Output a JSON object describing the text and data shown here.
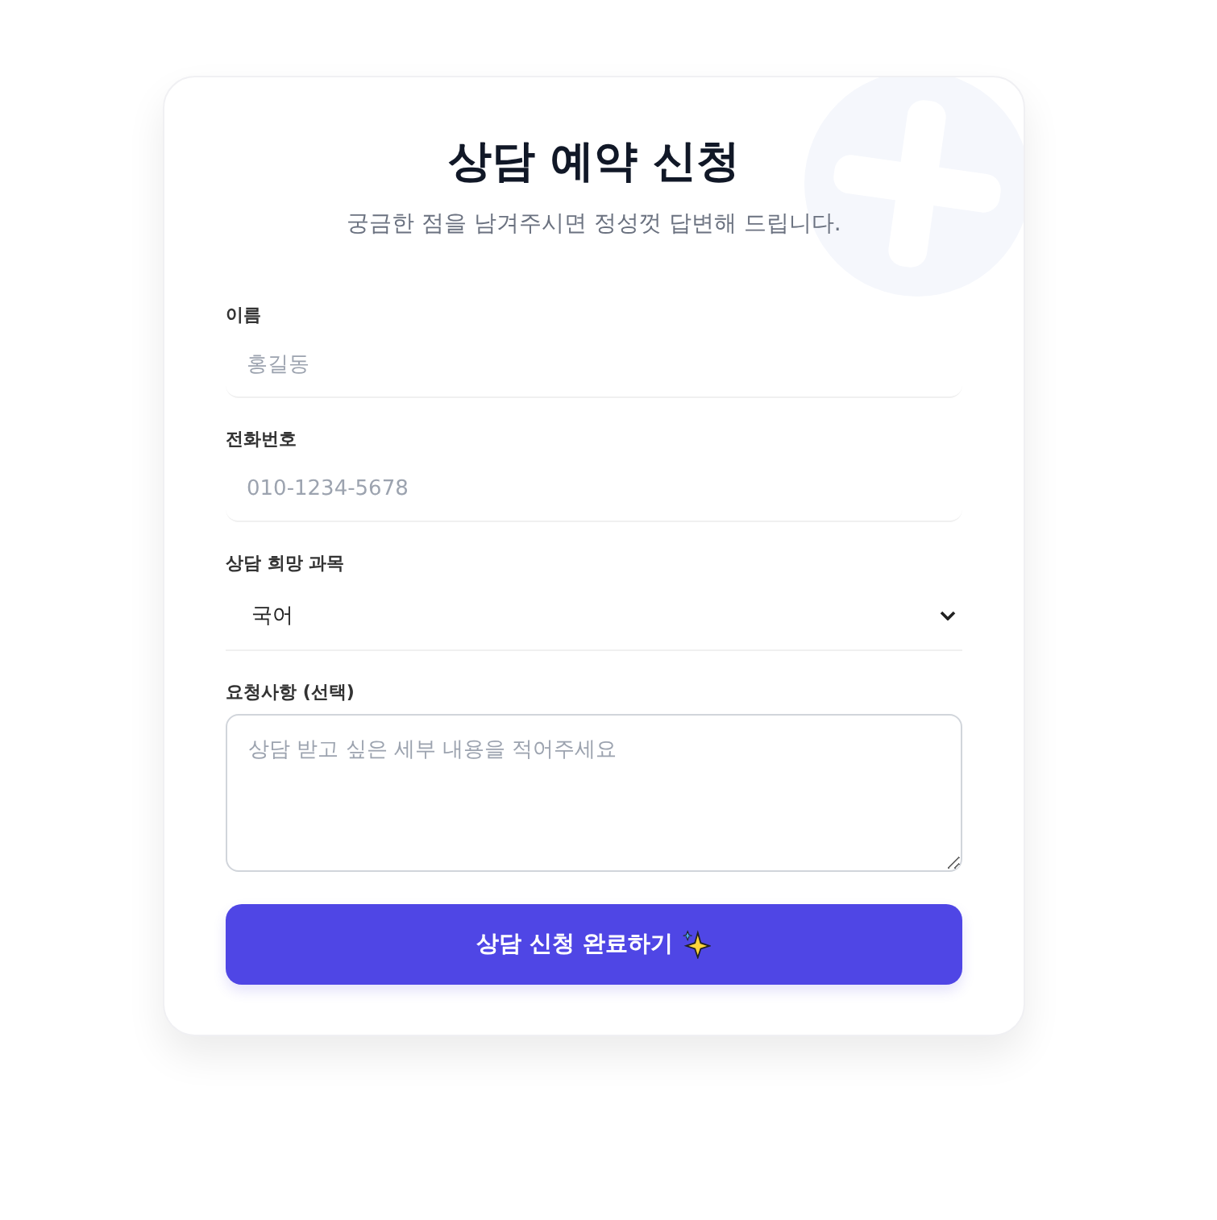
{
  "title": "상담 예약 신청",
  "subtitle": "궁금한 점을 남겨주시면 정성껏 답변해 드립니다.",
  "fields": [
    {
      "kind": "text",
      "label": "이름",
      "placeholder": "홍길동"
    },
    {
      "kind": "text",
      "label": "전화번호",
      "placeholder": "010-1234-5678"
    },
    {
      "kind": "select",
      "label": "상담 희망 과목",
      "value": "국어"
    },
    {
      "kind": "textarea",
      "label": "요청사항 (선택)",
      "placeholder": "상담 받고 싶은 세부 내용을 적어주세요"
    }
  ],
  "submit": {
    "label": "상담 신청 완료하기"
  }
}
